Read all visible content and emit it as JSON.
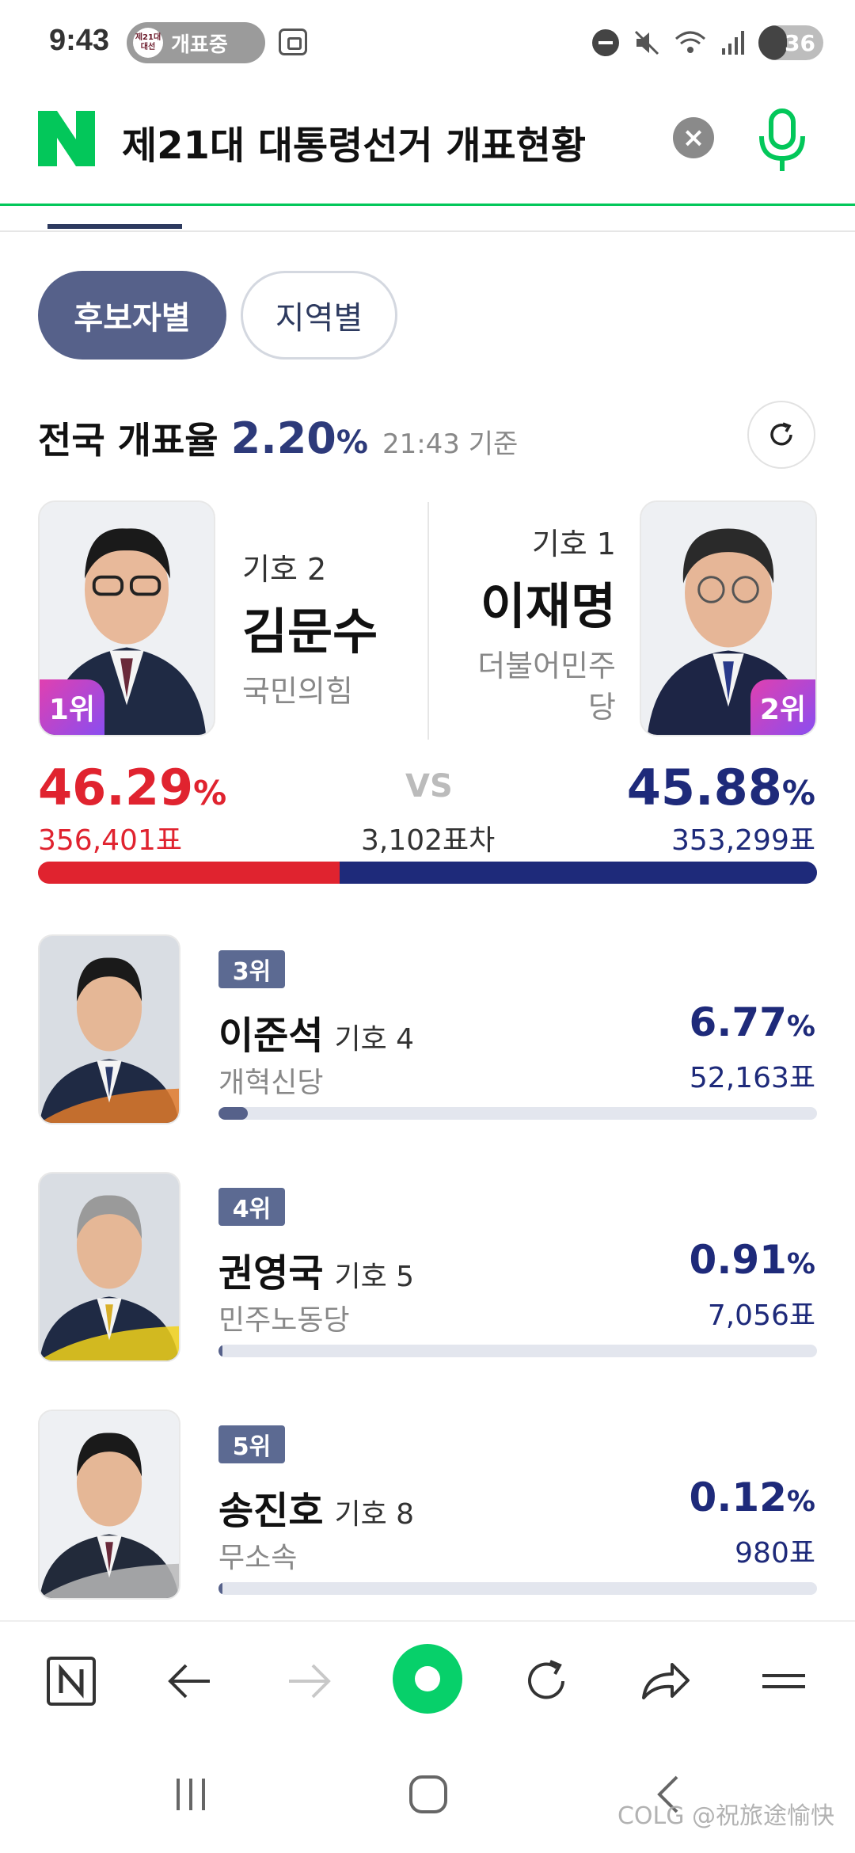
{
  "status_bar": {
    "time": "9:43",
    "pill_logo": "제21대 대선",
    "pill_text": "개표중",
    "battery": "36"
  },
  "search": {
    "query": "제21대 대통령선거 개표현황",
    "brand_color": "#03c75a"
  },
  "filters": [
    {
      "label": "후보자별",
      "active": true
    },
    {
      "label": "지역별",
      "active": false
    }
  ],
  "overall": {
    "label": "전국 개표율",
    "rate": "2.20",
    "unit": "%",
    "time": "21:43 기준"
  },
  "top_candidates": {
    "left": {
      "number": "기호 2",
      "name": "김문수",
      "party": "국민의힘",
      "rank": "1위",
      "pct": "46.29",
      "votes": "356,401표",
      "color": "#e0232f"
    },
    "right": {
      "number": "기호 1",
      "name": "이재명",
      "party": "더불어민주당",
      "rank": "2위",
      "pct": "45.88",
      "votes": "353,299표",
      "color": "#1e2a7a"
    },
    "vs": "VS",
    "diff": "3,102표차",
    "pct_unit": "%",
    "bar_shares": {
      "left": 0.4629,
      "right": 0.4588
    }
  },
  "other_candidates": [
    {
      "rank": "3위",
      "name": "이준석",
      "number": "기호 4",
      "party": "개혁신당",
      "pct": "6.77",
      "votes": "52,163표",
      "share": 0.0677
    },
    {
      "rank": "4위",
      "name": "권영국",
      "number": "기호 5",
      "party": "민주노동당",
      "pct": "0.91",
      "votes": "7,056표",
      "share": 0.0091
    },
    {
      "rank": "5위",
      "name": "송진호",
      "number": "기호 8",
      "party": "무소속",
      "pct": "0.12",
      "votes": "980표",
      "share": 0.0012
    }
  ],
  "toolbar": {
    "icons": [
      "naver-home-icon",
      "back-arrow-icon",
      "forward-arrow-icon",
      "green-dot-icon",
      "reload-icon",
      "share-icon",
      "menu-icon"
    ]
  },
  "watermark": "COLG @祝旅途愉快"
}
